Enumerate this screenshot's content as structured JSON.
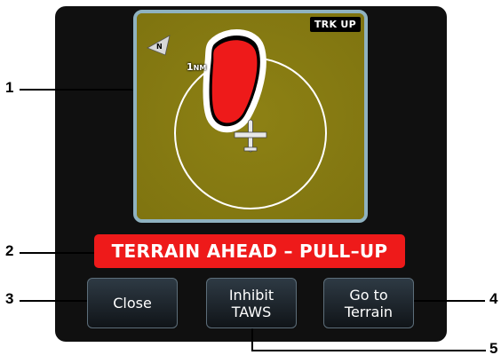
{
  "map": {
    "orientation_badge": "TRK UP",
    "north_indicator": "N",
    "range_value": "1",
    "range_unit": "NM",
    "terrain_colors": {
      "safe": "#8a7e12",
      "warning": "#ee1a1a"
    }
  },
  "alert": {
    "text": "TERRAIN AHEAD – PULL–UP",
    "color": "#ee1a1a"
  },
  "buttons": {
    "close": "Close",
    "inhibit": "Inhibit\nTAWS",
    "goto": "Go to\nTerrain"
  },
  "callouts": [
    "1",
    "2",
    "3",
    "4",
    "5"
  ]
}
